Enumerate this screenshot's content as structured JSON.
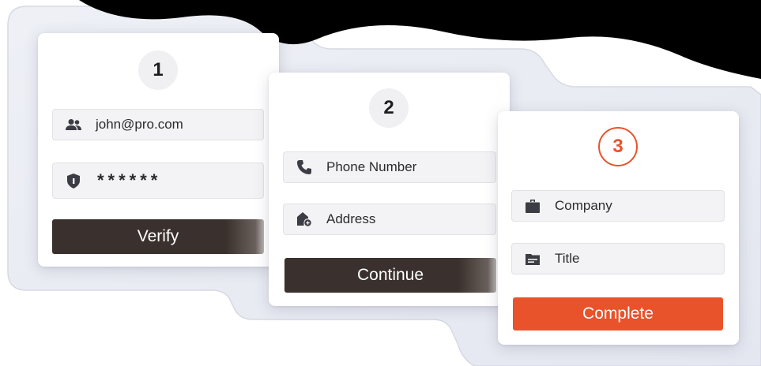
{
  "colors": {
    "accent": "#e8532b",
    "dark_button": "#3a302d",
    "field_bg": "#f3f3f5",
    "header_black": "#000000"
  },
  "steps": [
    {
      "number": "1",
      "fields": [
        {
          "icon": "users-icon",
          "value": "john@pro.com"
        },
        {
          "icon": "shield-icon",
          "value": "******"
        }
      ],
      "button": "Verify"
    },
    {
      "number": "2",
      "fields": [
        {
          "icon": "phone-icon",
          "placeholder": "Phone Number"
        },
        {
          "icon": "home-add-icon",
          "placeholder": "Address"
        }
      ],
      "button": "Continue"
    },
    {
      "number": "3",
      "fields": [
        {
          "icon": "briefcase-icon",
          "placeholder": "Company"
        },
        {
          "icon": "id-card-icon",
          "placeholder": "Title"
        }
      ],
      "button": "Complete"
    }
  ]
}
